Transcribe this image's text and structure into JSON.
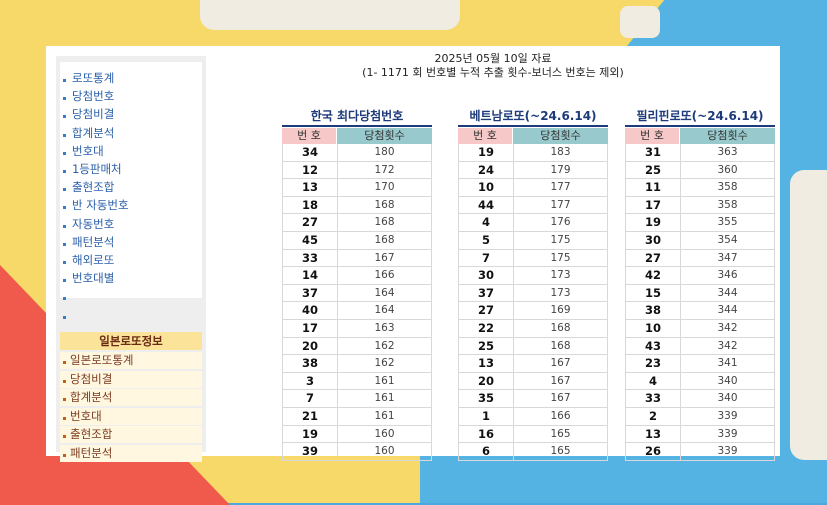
{
  "header": {
    "date": "2025년 05월 10일 자료",
    "desc": "(1- 1171 회 번호별 누적 추출 횟수-보너스 번호는 제외)"
  },
  "sidebar": {
    "menu": [
      "로또통계",
      "당첨번호",
      "당첨비결",
      "합계분석",
      "번호대",
      "1등판매처",
      "출현조합",
      "반 자동번호",
      "자동번호",
      "패턴분석",
      "해외로또",
      "번호대별",
      "",
      ""
    ],
    "jp_title": "일본로또정보",
    "jp_menu": [
      "일본로또통계",
      "당첨비결",
      "합계분석",
      "번호대",
      "출현조합",
      "패턴분석"
    ]
  },
  "tables": [
    {
      "title": "한국 최다당첨번호",
      "col_num": "번 호",
      "col_cnt": "당첨횟수",
      "rows": [
        [
          "34",
          "180"
        ],
        [
          "12",
          "172"
        ],
        [
          "13",
          "170"
        ],
        [
          "18",
          "168"
        ],
        [
          "27",
          "168"
        ],
        [
          "45",
          "168"
        ],
        [
          "33",
          "167"
        ],
        [
          "14",
          "166"
        ],
        [
          "37",
          "164"
        ],
        [
          "40",
          "164"
        ],
        [
          "17",
          "163"
        ],
        [
          "20",
          "162"
        ],
        [
          "38",
          "162"
        ],
        [
          "3",
          "161"
        ],
        [
          "7",
          "161"
        ],
        [
          "21",
          "161"
        ],
        [
          "19",
          "160"
        ],
        [
          "39",
          "160"
        ]
      ]
    },
    {
      "title": "베트남로또(~24.6.14)",
      "col_num": "번 호",
      "col_cnt": "당첨횟수",
      "rows": [
        [
          "19",
          "183"
        ],
        [
          "24",
          "179"
        ],
        [
          "10",
          "177"
        ],
        [
          "44",
          "177"
        ],
        [
          "4",
          "176"
        ],
        [
          "5",
          "175"
        ],
        [
          "7",
          "175"
        ],
        [
          "30",
          "173"
        ],
        [
          "37",
          "173"
        ],
        [
          "27",
          "169"
        ],
        [
          "22",
          "168"
        ],
        [
          "25",
          "168"
        ],
        [
          "13",
          "167"
        ],
        [
          "20",
          "167"
        ],
        [
          "35",
          "167"
        ],
        [
          "1",
          "166"
        ],
        [
          "16",
          "165"
        ],
        [
          "6",
          "165"
        ]
      ]
    },
    {
      "title": "필리핀로또(~24.6.14)",
      "col_num": "번 호",
      "col_cnt": "당첨횟수",
      "rows": [
        [
          "31",
          "363"
        ],
        [
          "25",
          "360"
        ],
        [
          "11",
          "358"
        ],
        [
          "17",
          "358"
        ],
        [
          "19",
          "355"
        ],
        [
          "30",
          "354"
        ],
        [
          "27",
          "347"
        ],
        [
          "42",
          "346"
        ],
        [
          "15",
          "344"
        ],
        [
          "38",
          "344"
        ],
        [
          "10",
          "342"
        ],
        [
          "43",
          "342"
        ],
        [
          "23",
          "341"
        ],
        [
          "4",
          "340"
        ],
        [
          "33",
          "340"
        ],
        [
          "2",
          "339"
        ],
        [
          "13",
          "339"
        ],
        [
          "26",
          "339"
        ]
      ]
    }
  ]
}
